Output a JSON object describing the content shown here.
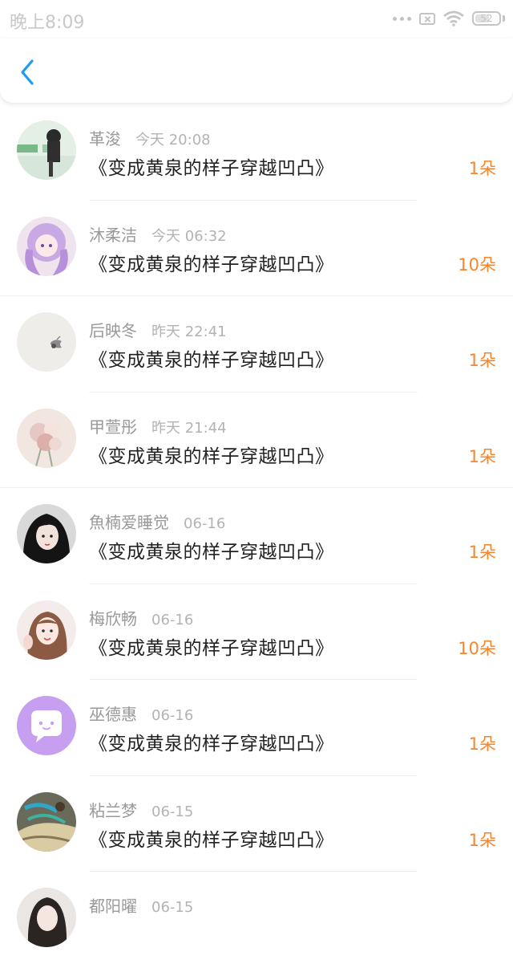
{
  "status_bar": {
    "time": "晚上8:09",
    "battery": "52"
  },
  "colors": {
    "accent": "#1e9bf0",
    "count": "#f7852c"
  },
  "nav": {
    "back_icon": "chevron-left-icon"
  },
  "rows": [
    {
      "name": "革浚",
      "time": "今天 20:08",
      "book": "《变成黄泉的样子穿越凹凸》",
      "count": "1朵"
    },
    {
      "name": "沐柔洁",
      "time": "今天 06:32",
      "book": "《变成黄泉的样子穿越凹凸》",
      "count": "10朵"
    },
    {
      "name": "后映冬",
      "time": "昨天 22:41",
      "book": "《变成黄泉的样子穿越凹凸》",
      "count": "1朵"
    },
    {
      "name": "甲萱彤",
      "time": "昨天 21:44",
      "book": "《变成黄泉的样子穿越凹凸》",
      "count": "1朵"
    },
    {
      "name": "魚楠爱睡觉",
      "time": "06-16",
      "book": "《变成黄泉的样子穿越凹凸》",
      "count": "1朵"
    },
    {
      "name": "梅欣畅",
      "time": "06-16",
      "book": "《变成黄泉的样子穿越凹凸》",
      "count": "10朵"
    },
    {
      "name": "巫德惠",
      "time": "06-16",
      "book": "《变成黄泉的样子穿越凹凸》",
      "count": "1朵"
    },
    {
      "name": "粘兰梦",
      "time": "06-15",
      "book": "《变成黄泉的样子穿越凹凸》",
      "count": "1朵"
    },
    {
      "name": "都阳曜",
      "time": "06-15",
      "book": "",
      "count": ""
    }
  ]
}
